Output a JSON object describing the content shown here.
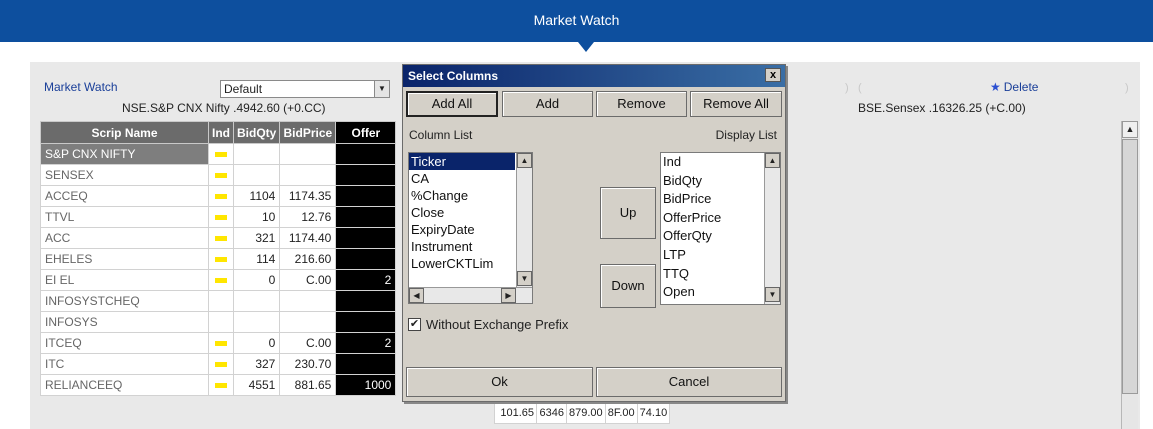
{
  "header": {
    "title": "Market Watch"
  },
  "toolbar": {
    "market_watch_label": "Market Watch",
    "watch_select_value": "Default",
    "delete_label": "Delete"
  },
  "tickers": {
    "nse": "NSE.S&P CNX Nifty .4942.60 (+0.CC)",
    "bse": "BSE.Sensex .16326.25 (+C.00)"
  },
  "grid": {
    "columns": [
      "Scrip Name",
      "Ind",
      "BidQty",
      "BidPrice",
      "Offer"
    ],
    "rows": [
      {
        "name": "S&P CNX NIFTY",
        "ind": true,
        "bidqty": "",
        "bidprice": "",
        "offer": ""
      },
      {
        "name": "SENSEX",
        "ind": true,
        "bidqty": "",
        "bidprice": "",
        "offer": ""
      },
      {
        "name": "ACCEQ",
        "ind": true,
        "bidqty": "1104",
        "bidprice": "1174.35",
        "offer": ""
      },
      {
        "name": "TTVL",
        "ind": true,
        "bidqty": "10",
        "bidprice": "12.76",
        "offer": ""
      },
      {
        "name": "ACC",
        "ind": true,
        "bidqty": "321",
        "bidprice": "1174.40",
        "offer": ""
      },
      {
        "name": "EHELES",
        "ind": true,
        "bidqty": "114",
        "bidprice": "216.60",
        "offer": ""
      },
      {
        "name": "EI EL",
        "ind": true,
        "bidqty": "0",
        "bidprice": "C.00",
        "offer": "2"
      },
      {
        "name": "INFOSYSTCHEQ",
        "ind": false,
        "bidqty": "",
        "bidprice": "",
        "offer": ""
      },
      {
        "name": "INFOSYS",
        "ind": false,
        "bidqty": "",
        "bidprice": "",
        "offer": ""
      },
      {
        "name": "ITCEQ",
        "ind": true,
        "bidqty": "0",
        "bidprice": "C.00",
        "offer": "2"
      },
      {
        "name": "ITC",
        "ind": true,
        "bidqty": "327",
        "bidprice": "230.70",
        "offer": ""
      },
      {
        "name": "RELIANCEEQ",
        "ind": true,
        "bidqty": "4551",
        "bidprice": "881.65",
        "offer": "1000"
      }
    ],
    "last_row_extra": [
      "101.65",
      "6346",
      "879.00",
      "8F.00",
      "74.10"
    ]
  },
  "dialog": {
    "title": "Select Columns",
    "close_label": "x",
    "buttons": {
      "add_all": "Add All",
      "add": "Add",
      "remove": "Remove",
      "remove_all": "Remove All",
      "up": "Up",
      "down": "Down",
      "ok": "Ok",
      "cancel": "Cancel"
    },
    "column_list_label": "Column List",
    "display_list_label": "Display List",
    "column_list": [
      "Ticker",
      "CA",
      "%Change",
      "Close",
      "ExpiryDate",
      "Instrument",
      "LowerCKTLim"
    ],
    "column_list_selected": "Ticker",
    "display_list": [
      "Ind",
      "BidQty",
      "BidPrice",
      "OfferPrice",
      "OfferQty",
      "LTP",
      "TTQ",
      "Open"
    ],
    "checkbox_label": "Without Exchange Prefix",
    "checkbox_checked": true
  }
}
